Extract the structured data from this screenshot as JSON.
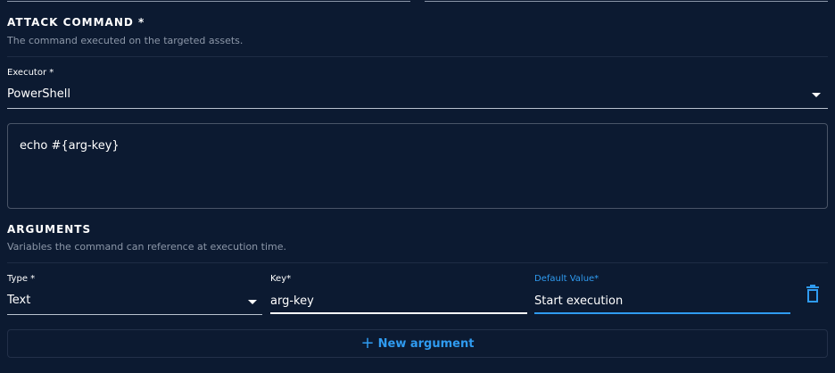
{
  "attack_command": {
    "title": "ATTACK COMMAND *",
    "description": "The command executed on the targeted assets."
  },
  "executor": {
    "label": "Executor *",
    "value": "PowerShell"
  },
  "command": {
    "value": "echo #{arg-key}"
  },
  "arguments": {
    "title": "ARGUMENTS",
    "description": "Variables the command can reference at execution time.",
    "type_label": "Type *",
    "type_value": "Text",
    "key_label": "Key*",
    "key_value": "arg-key",
    "default_label": "Default Value*",
    "default_value": "Start execution",
    "new_argument_label": "New argument"
  },
  "colors": {
    "background": "#0c1a31",
    "accent": "#2f9bf0",
    "muted_text": "#8c97a8"
  },
  "icons": {
    "delete": "trash-icon",
    "add": "plus-icon",
    "dropdown": "caret-down-icon"
  }
}
